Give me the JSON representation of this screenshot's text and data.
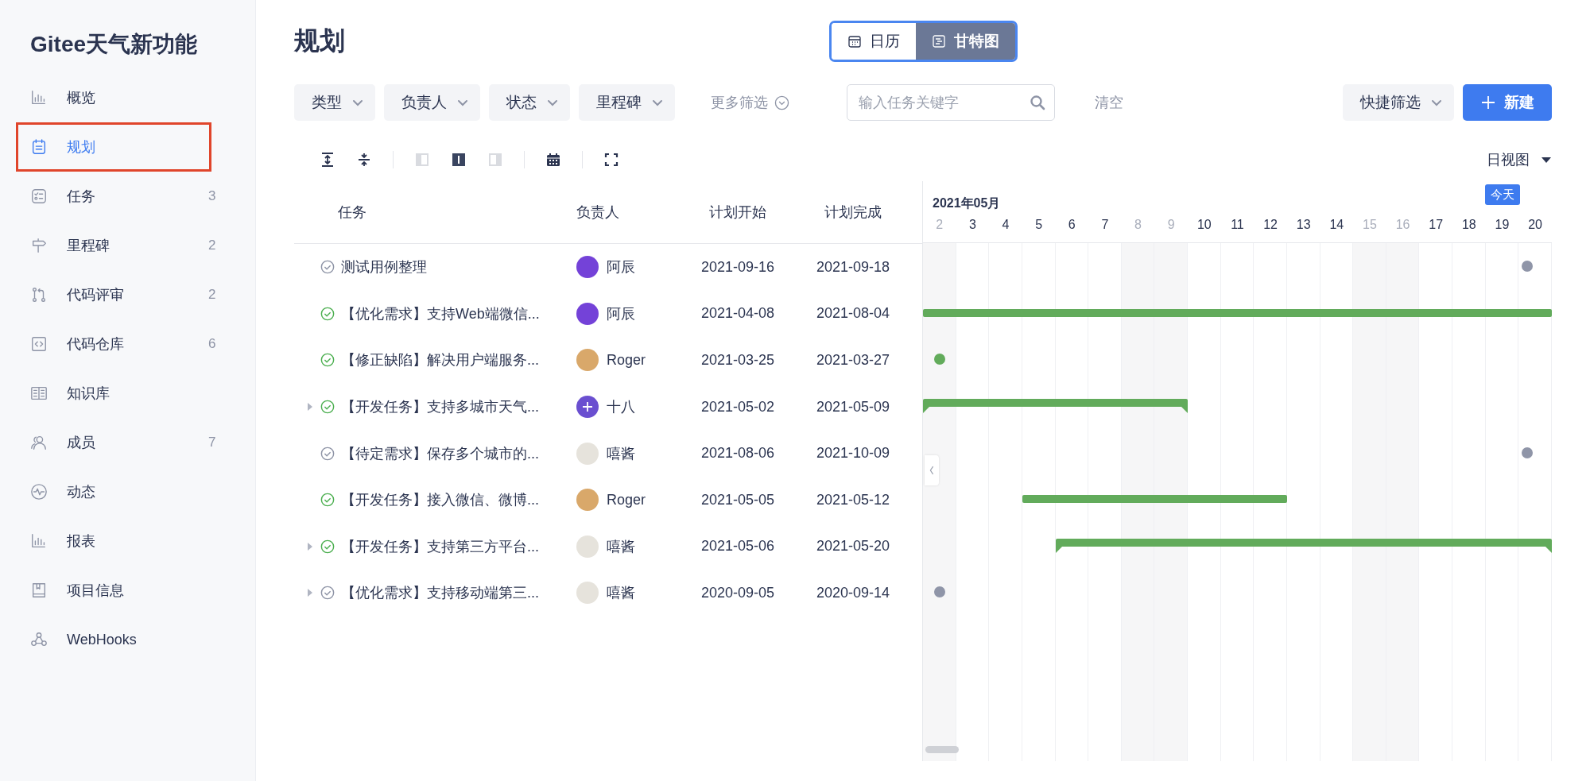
{
  "sidebar": {
    "title": "Gitee天气新功能",
    "items": [
      {
        "label": "概览",
        "selected": false
      },
      {
        "label": "规划",
        "selected": true
      },
      {
        "label": "任务",
        "count": "3",
        "selected": false
      },
      {
        "label": "里程碑",
        "count": "2",
        "selected": false
      },
      {
        "label": "代码评审",
        "count": "2",
        "selected": false
      },
      {
        "label": "代码仓库",
        "count": "6",
        "selected": false
      },
      {
        "label": "知识库",
        "selected": false
      },
      {
        "label": "成员",
        "count": "7",
        "selected": false
      },
      {
        "label": "动态",
        "selected": false
      },
      {
        "label": "报表",
        "selected": false
      },
      {
        "label": "项目信息",
        "selected": false
      },
      {
        "label": "WebHooks",
        "selected": false
      }
    ]
  },
  "page": {
    "title": "规划",
    "view_tabs": [
      {
        "label": "日历",
        "selected": false
      },
      {
        "label": "甘特图",
        "selected": true
      }
    ]
  },
  "filters": [
    {
      "label": "类型"
    },
    {
      "label": "负责人"
    },
    {
      "label": "状态"
    },
    {
      "label": "里程碑"
    }
  ],
  "more_filters": "更多筛选",
  "search": {
    "placeholder": "输入任务关键字"
  },
  "clear": "清空",
  "quick_filter": "快捷筛选",
  "new_button": "新建",
  "toolbar": {
    "layout_modes": [
      {
        "selected": false
      },
      {
        "selected": true
      },
      {
        "selected": false
      }
    ],
    "view_select": "日视图"
  },
  "table": {
    "columns": [
      "任务",
      "负责人",
      "计划开始",
      "计划完成"
    ],
    "rows": [
      {
        "task": "测试用例整理",
        "done": false,
        "expandable": false,
        "assignee": "阿辰",
        "avatar": {
          "kind": "photo",
          "color": "#7442d8"
        },
        "start": "2021-09-16",
        "end": "2021-09-18"
      },
      {
        "task": "【优化需求】支持Web端微信...",
        "done": true,
        "expandable": false,
        "assignee": "阿辰",
        "avatar": {
          "kind": "photo",
          "color": "#7442d8"
        },
        "start": "2021-04-08",
        "end": "2021-08-04"
      },
      {
        "task": "【修正缺陷】解决用户端服务...",
        "done": true,
        "expandable": false,
        "assignee": "Roger",
        "avatar": {
          "kind": "photo",
          "color": "#d9a86a"
        },
        "start": "2021-03-25",
        "end": "2021-03-27"
      },
      {
        "task": "【开发任务】支持多城市天气...",
        "done": true,
        "expandable": true,
        "assignee": "十八",
        "avatar": {
          "kind": "plus",
          "color": "#6a4fd0"
        },
        "start": "2021-05-02",
        "end": "2021-05-09"
      },
      {
        "task": "【待定需求】保存多个城市的...",
        "done": false,
        "expandable": false,
        "assignee": "嘻酱",
        "avatar": {
          "kind": "photo",
          "color": "#e6e3dc"
        },
        "start": "2021-08-06",
        "end": "2021-10-09"
      },
      {
        "task": "【开发任务】接入微信、微博...",
        "done": true,
        "expandable": false,
        "assignee": "Roger",
        "avatar": {
          "kind": "photo",
          "color": "#d9a86a"
        },
        "start": "2021-05-05",
        "end": "2021-05-12"
      },
      {
        "task": "【开发任务】支持第三方平台...",
        "done": true,
        "expandable": true,
        "assignee": "嘻酱",
        "avatar": {
          "kind": "photo",
          "color": "#e6e3dc"
        },
        "start": "2021-05-06",
        "end": "2021-05-20"
      },
      {
        "task": "【优化需求】支持移动端第三...",
        "done": false,
        "expandable": true,
        "assignee": "嘻酱",
        "avatar": {
          "kind": "photo",
          "color": "#e6e3dc"
        },
        "start": "2020-09-05",
        "end": "2020-09-14"
      }
    ]
  },
  "gantt": {
    "month": "2021年05月",
    "today_label": "今天",
    "days": [
      {
        "label": "2",
        "weekend": true,
        "today": false
      },
      {
        "label": "3",
        "weekend": false,
        "today": false
      },
      {
        "label": "4",
        "weekend": false,
        "today": false
      },
      {
        "label": "5",
        "weekend": false,
        "today": false
      },
      {
        "label": "6",
        "weekend": false,
        "today": false
      },
      {
        "label": "7",
        "weekend": false,
        "today": false
      },
      {
        "label": "8",
        "weekend": true,
        "today": false
      },
      {
        "label": "9",
        "weekend": true,
        "today": false
      },
      {
        "label": "10",
        "weekend": false,
        "today": false
      },
      {
        "label": "11",
        "weekend": false,
        "today": false
      },
      {
        "label": "12",
        "weekend": false,
        "today": false
      },
      {
        "label": "13",
        "weekend": false,
        "today": false
      },
      {
        "label": "14",
        "weekend": false,
        "today": false
      },
      {
        "label": "15",
        "weekend": true,
        "today": false
      },
      {
        "label": "16",
        "weekend": true,
        "today": false
      },
      {
        "label": "17",
        "weekend": false,
        "today": false
      },
      {
        "label": "18",
        "weekend": false,
        "today": false
      },
      {
        "label": "19",
        "weekend": false,
        "today": true
      },
      {
        "label": "20",
        "weekend": false,
        "today": false
      }
    ]
  }
}
